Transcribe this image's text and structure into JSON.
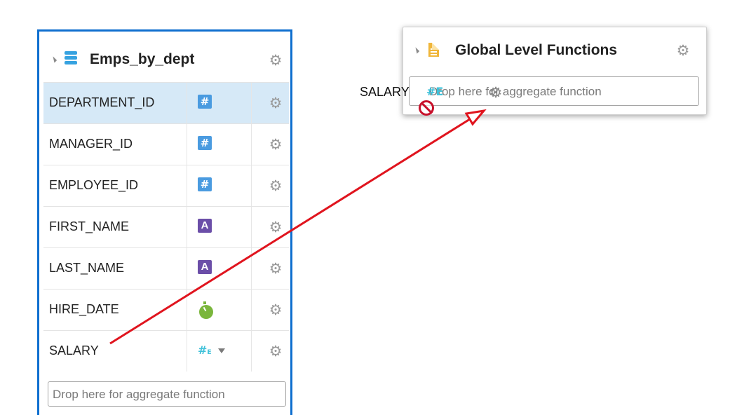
{
  "left_table": {
    "title": "Emps_by_dept",
    "icon": "database-table-icon",
    "columns": [
      {
        "name": "DEPARTMENT_ID",
        "type_icon": "numeric-icon",
        "type_glyph": "#",
        "selected": true
      },
      {
        "name": "MANAGER_ID",
        "type_icon": "numeric-icon",
        "type_glyph": "#",
        "selected": false
      },
      {
        "name": "EMPLOYEE_ID",
        "type_icon": "numeric-icon",
        "type_glyph": "#",
        "selected": false
      },
      {
        "name": "FIRST_NAME",
        "type_icon": "string-icon",
        "type_glyph": "A",
        "selected": false
      },
      {
        "name": "LAST_NAME",
        "type_icon": "string-icon",
        "type_glyph": "A",
        "selected": false
      },
      {
        "name": "HIRE_DATE",
        "type_icon": "date-timer-icon",
        "type_glyph": "",
        "selected": false
      },
      {
        "name": "SALARY",
        "type_icon": "numeric-expression-icon",
        "type_glyph": "#E",
        "selected": false
      }
    ],
    "drop_placeholder": "Drop here for aggregate function"
  },
  "right_panel": {
    "title": "Global Level Functions",
    "icon": "document-icon",
    "drop_placeholder": "Drop here for aggregate function"
  },
  "drag": {
    "label": "SALARY",
    "type_glyph": "#E"
  },
  "colors": {
    "selection_border": "#0f6fcf",
    "selected_row": "#d6e9f7",
    "numeric_icon": "#4a9be0",
    "string_icon": "#6b4ea8",
    "date_icon": "#7ab63c",
    "annotation_arrow": "#e0141e",
    "no_drop": "#c8112b"
  }
}
